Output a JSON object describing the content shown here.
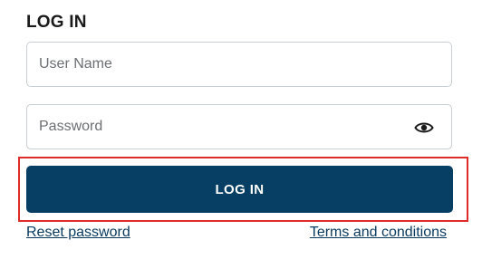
{
  "form": {
    "title": "LOG IN",
    "username": {
      "placeholder": "User Name",
      "value": ""
    },
    "password": {
      "placeholder": "Password",
      "value": ""
    },
    "show_password_icon": "eye-icon",
    "submit_label": "LOG IN",
    "reset_link": "Reset password",
    "terms_link": "Terms and conditions"
  },
  "colors": {
    "button_bg": "#063f63",
    "link": "#0b3b60",
    "highlight": "#e02b2b",
    "field_border": "#c9ced4"
  }
}
